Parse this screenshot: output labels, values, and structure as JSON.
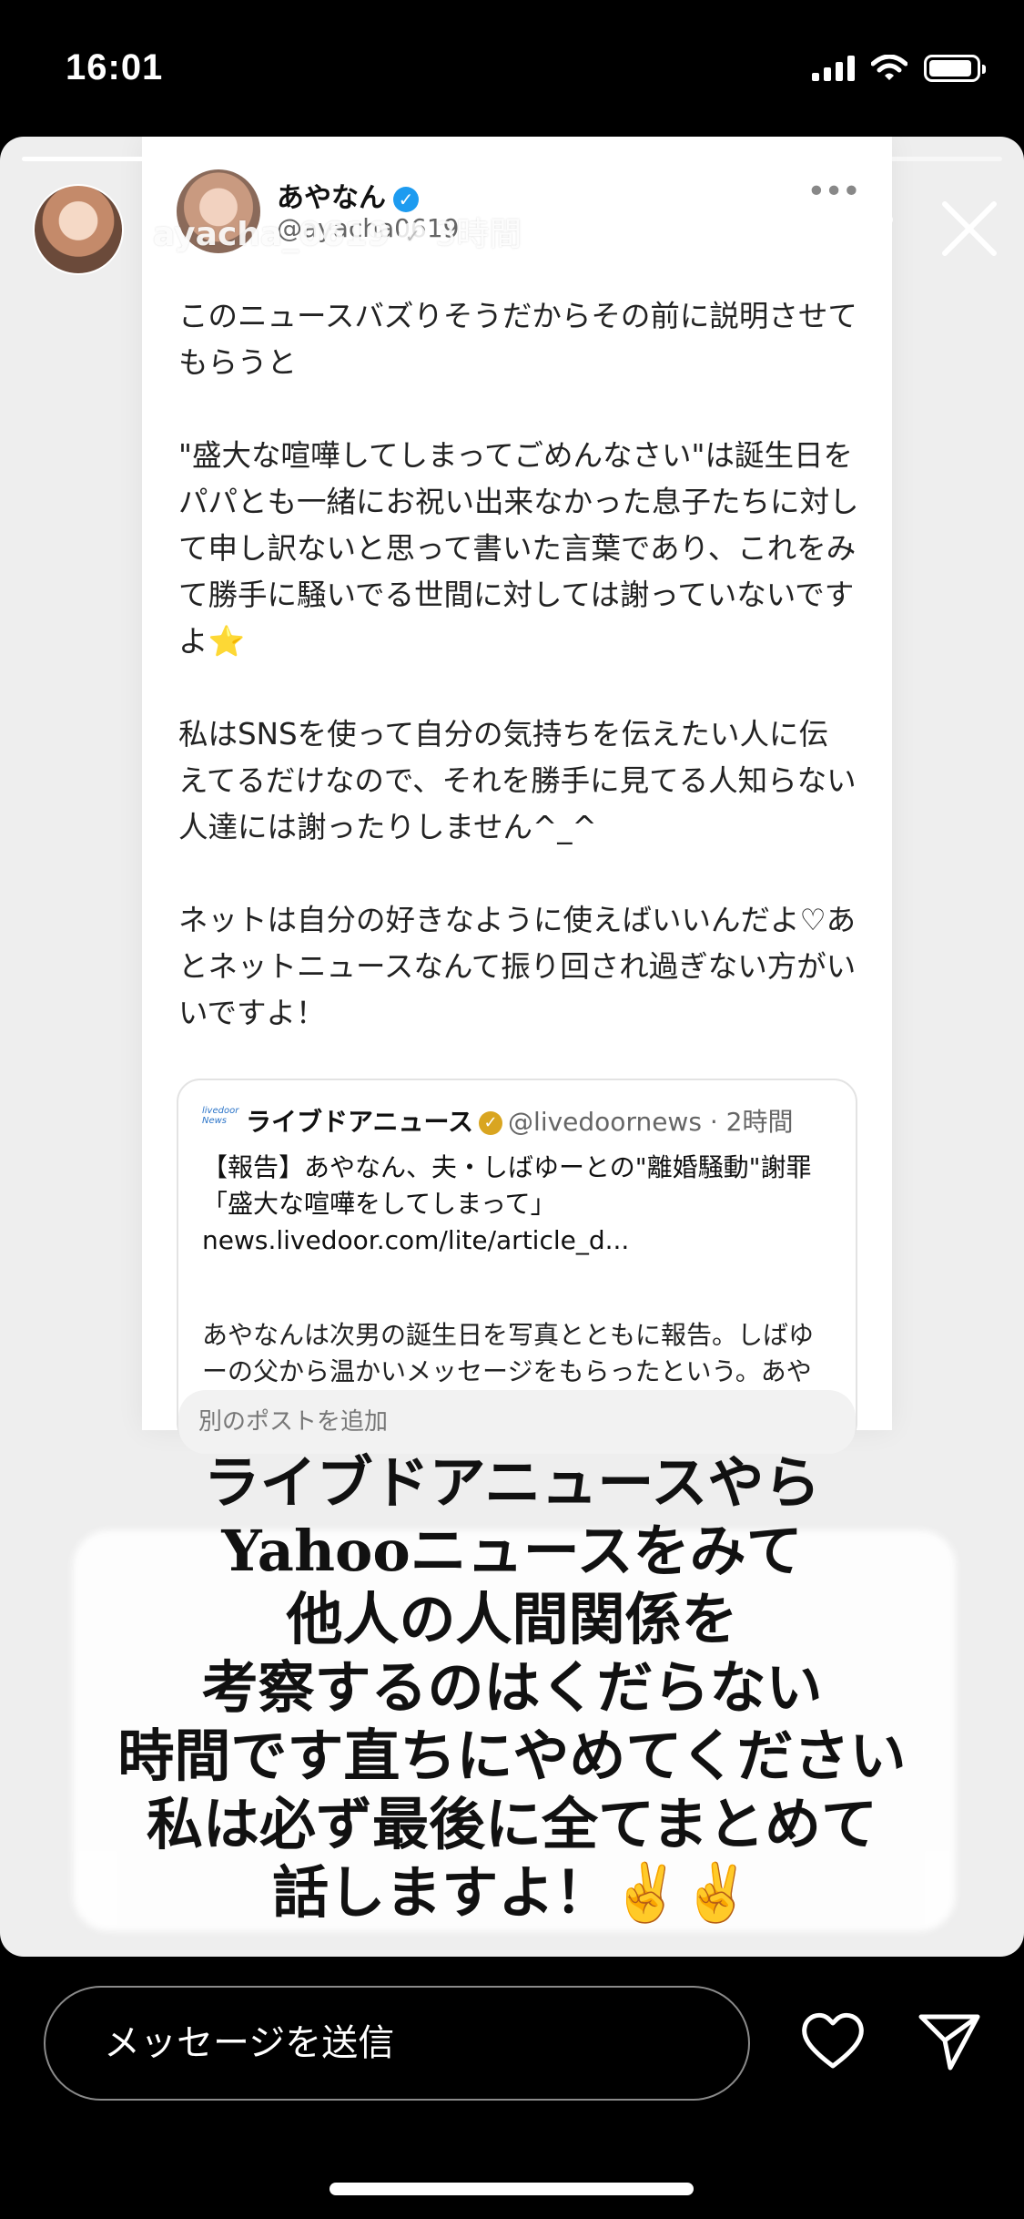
{
  "status_bar": {
    "time": "16:01"
  },
  "story": {
    "progress_total": 4,
    "progress_completed": 2,
    "username": "ayacha_0619",
    "time_ago": "3時間",
    "tweet": {
      "display_name": "あやなん",
      "handle": "@ayacha0619",
      "text": "このニュースバズりそうだからその前に説明させて\nもらうと\n\n\"盛大な喧嘩してしまってごめんなさい\"は誕生日を\nパパとも一緒にお祝い出来なかった息子たちに対し\nて申し訳ないと思って書いた言葉であり、これをみ\nて勝手に騒いでる世間に対しては謝っていないです\nよ⭐\n\n私はSNSを使って自分の気持ちを伝えたい人に伝\nえてるだけなので、それを勝手に見てる人知らない\n人達には謝ったりしません^_^\n\nネットは自分の好きなように使えばいいんだよ♡あ\nとネットニュースなんて振り回され過ぎない方がい\nいですよ！",
      "quote": {
        "logo_text": "livedoor News",
        "name": "ライブドアニュース",
        "handle": "@livedoornews",
        "time": "2時間",
        "headline": "【報告】あやなん、夫・しばゆーとの\"離婚騒動\"謝罪\n「盛大な喧嘩をしてしまって」\nnews.livedoor.com/lite/article_d...",
        "body": "あやなんは次男の誕生日を写真とともに報告。しばゆ\nーの父から温かいメッセージをもらったという。あや\nなんは「こんなに盛大な喧嘩をしてしまってごめんな"
      },
      "add_post_placeholder": "別のポストを追加"
    },
    "overlay_text": "ライブドアニュースやら\nYahooニュースをみて\n他人の人間関係を\n考察するのはくだらない\n時間です直ちにやめてください\n私は必ず最後に全てまとめて\n話しますよ！✌️✌️"
  },
  "footer": {
    "message_placeholder": "メッセージを送信"
  },
  "icons": {
    "close": "close-icon",
    "more": "more-icon",
    "heart": "heart-icon",
    "send": "send-icon"
  }
}
